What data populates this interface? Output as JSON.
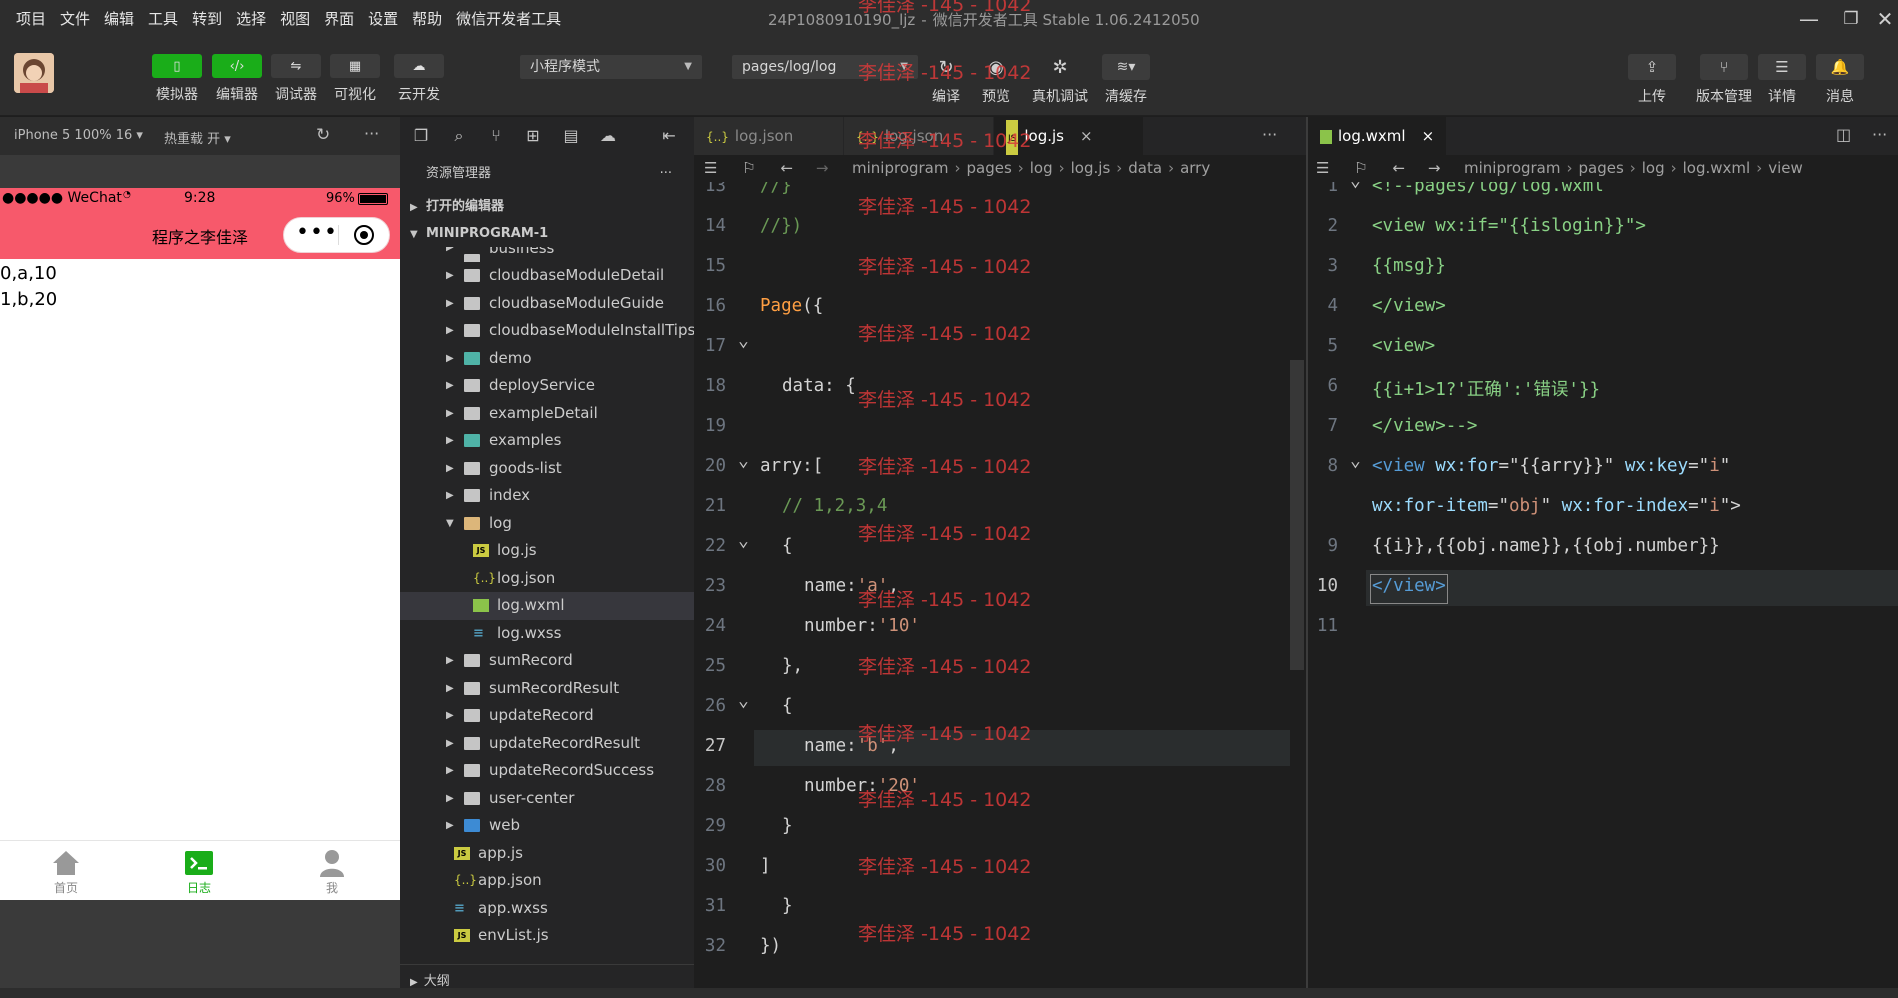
{
  "menu": [
    "项目",
    "文件",
    "编辑",
    "工具",
    "转到",
    "选择",
    "视图",
    "界面",
    "设置",
    "帮助",
    "微信开发者工具"
  ],
  "window": {
    "project": "24P1080910190_ljz",
    "sep": "-",
    "app": "微信开发者工具 Stable 1.06.2412050",
    "minimize_icon": "minimize-icon",
    "maximize_icon": "maximize-icon",
    "close_icon": "close-icon"
  },
  "toolbar": {
    "left_buttons": [
      {
        "label": "模拟器",
        "icon": "phone-icon",
        "active": true
      },
      {
        "label": "编辑器",
        "icon": "code-icon",
        "active": true
      },
      {
        "label": "调试器",
        "icon": "debug-icon",
        "active": false
      },
      {
        "label": "可视化",
        "icon": "layout-icon",
        "active": false
      },
      {
        "label": "云开发",
        "icon": "cloud-icon",
        "active": false
      }
    ],
    "mode_select": "小程序模式",
    "page_select": "pages/log/log",
    "mid_buttons": [
      {
        "label": "编译",
        "icon": "compile-icon"
      },
      {
        "label": "预览",
        "icon": "eye-icon"
      },
      {
        "label": "真机调试",
        "icon": "bug-icon"
      },
      {
        "label": "清缓存",
        "icon": "layers-icon"
      }
    ],
    "right_buttons": [
      {
        "label": "上传",
        "icon": "upload-icon"
      },
      {
        "label": "版本管理",
        "icon": "branch-icon"
      },
      {
        "label": "详情",
        "icon": "menu-icon"
      },
      {
        "label": "消息",
        "icon": "bell-icon"
      }
    ]
  },
  "simulator": {
    "device": "iPhone 5 100% 16 ▾",
    "hot_reload": "热重载 开 ▾",
    "status_left": "●●●●● WeChat",
    "status_time": "9:28",
    "status_battery": "96%",
    "nav_title": "程序之李佳泽",
    "body_lines": [
      "0,a,10",
      "1,b,20"
    ],
    "tabs": [
      {
        "label": "首页",
        "icon": "home-icon"
      },
      {
        "label": "日志",
        "icon": "terminal-icon"
      },
      {
        "label": "我",
        "icon": "user-icon"
      }
    ]
  },
  "explorer": {
    "title": "资源管理器",
    "open_editors": "打开的编辑器",
    "project": "MINIPROGRAM-1",
    "outline": "大纲",
    "items": [
      {
        "label": "business",
        "kind": "folder",
        "depth": 1,
        "open": false,
        "clipped": true
      },
      {
        "label": "cloudbaseModuleDetail",
        "kind": "folder",
        "depth": 1,
        "open": false
      },
      {
        "label": "cloudbaseModuleGuide",
        "kind": "folder",
        "depth": 1,
        "open": false
      },
      {
        "label": "cloudbaseModuleInstallTips",
        "kind": "folder",
        "depth": 1,
        "open": false
      },
      {
        "label": "demo",
        "kind": "folder-special",
        "depth": 1,
        "open": false
      },
      {
        "label": "deployService",
        "kind": "folder",
        "depth": 1,
        "open": false
      },
      {
        "label": "exampleDetail",
        "kind": "folder",
        "depth": 1,
        "open": false
      },
      {
        "label": "examples",
        "kind": "folder-special",
        "depth": 1,
        "open": false
      },
      {
        "label": "goods-list",
        "kind": "folder",
        "depth": 1,
        "open": false
      },
      {
        "label": "index",
        "kind": "folder",
        "depth": 1,
        "open": false
      },
      {
        "label": "log",
        "kind": "folder",
        "depth": 1,
        "open": true
      },
      {
        "label": "log.js",
        "kind": "js",
        "depth": 2
      },
      {
        "label": "log.json",
        "kind": "json",
        "depth": 2
      },
      {
        "label": "log.wxml",
        "kind": "wxml",
        "depth": 2,
        "selected": true
      },
      {
        "label": "log.wxss",
        "kind": "wxss",
        "depth": 2
      },
      {
        "label": "sumRecord",
        "kind": "folder",
        "depth": 1,
        "open": false
      },
      {
        "label": "sumRecordResult",
        "kind": "folder",
        "depth": 1,
        "open": false
      },
      {
        "label": "updateRecord",
        "kind": "folder",
        "depth": 1,
        "open": false
      },
      {
        "label": "updateRecordResult",
        "kind": "folder",
        "depth": 1,
        "open": false
      },
      {
        "label": "updateRecordSuccess",
        "kind": "folder",
        "depth": 1,
        "open": false
      },
      {
        "label": "user-center",
        "kind": "folder",
        "depth": 1,
        "open": false
      },
      {
        "label": "web",
        "kind": "folder-special",
        "depth": 1,
        "open": false
      },
      {
        "label": "app.js",
        "kind": "js",
        "depth": 0
      },
      {
        "label": "app.json",
        "kind": "json",
        "depth": 0
      },
      {
        "label": "app.wxss",
        "kind": "wxss",
        "depth": 0
      },
      {
        "label": "envList.js",
        "kind": "js",
        "depth": 0
      }
    ]
  },
  "left_editor": {
    "tabs": [
      {
        "label": "log.json",
        "icon": "{..}",
        "active": false
      },
      {
        "label": "log.json",
        "icon": "{..}",
        "active": false
      },
      {
        "label": "log.js",
        "icon": "JS",
        "active": true
      }
    ],
    "breadcrumb": [
      "miniprogram",
      "pages",
      "log",
      "log.js",
      "data",
      "arry"
    ],
    "current_line": 27,
    "lines": [
      {
        "n": 13,
        "parts": [
          [
            "//}",
            "comment"
          ]
        ],
        "indent": 0
      },
      {
        "n": 14,
        "parts": [
          [
            "//})",
            "comment"
          ]
        ],
        "indent": 0
      },
      {
        "n": 15,
        "parts": [],
        "indent": 0
      },
      {
        "n": 16,
        "parts": [
          [
            "Page",
            "orange"
          ],
          [
            "({",
            "plain"
          ]
        ],
        "indent": 0
      },
      {
        "n": 17,
        "parts": [],
        "indent": 0,
        "fold": true
      },
      {
        "n": 18,
        "parts": [
          [
            "data",
            "plain"
          ],
          [
            ": {",
            "plain"
          ]
        ],
        "indent": 1
      },
      {
        "n": 19,
        "parts": [],
        "indent": 0
      },
      {
        "n": 20,
        "parts": [
          [
            "arry",
            "plain"
          ],
          [
            ":[",
            "plain"
          ]
        ],
        "indent": 0,
        "fold": true
      },
      {
        "n": 21,
        "parts": [
          [
            "// 1,2,3,4",
            "comment"
          ]
        ],
        "indent": 1
      },
      {
        "n": 22,
        "parts": [
          [
            "{",
            "plain"
          ]
        ],
        "indent": 1,
        "fold": true
      },
      {
        "n": 23,
        "parts": [
          [
            "name",
            "plain"
          ],
          [
            ":",
            "plain"
          ],
          [
            "'a'",
            "str"
          ],
          [
            ",",
            "plain"
          ]
        ],
        "indent": 2
      },
      {
        "n": 24,
        "parts": [
          [
            "number",
            "plain"
          ],
          [
            ":",
            "plain"
          ],
          [
            "'10'",
            "str"
          ]
        ],
        "indent": 2
      },
      {
        "n": 25,
        "parts": [
          [
            "},",
            "plain"
          ]
        ],
        "indent": 1
      },
      {
        "n": 26,
        "parts": [
          [
            "{",
            "plain"
          ]
        ],
        "indent": 1,
        "fold": true
      },
      {
        "n": 27,
        "parts": [
          [
            "name",
            "plain"
          ],
          [
            ":",
            "plain"
          ],
          [
            "'b'",
            "str"
          ],
          [
            ",",
            "plain"
          ]
        ],
        "indent": 2
      },
      {
        "n": 28,
        "parts": [
          [
            "number",
            "plain"
          ],
          [
            ":",
            "plain"
          ],
          [
            "'20'",
            "str"
          ]
        ],
        "indent": 2
      },
      {
        "n": 29,
        "parts": [
          [
            "}",
            "plain"
          ]
        ],
        "indent": 1
      },
      {
        "n": 30,
        "parts": [
          [
            "]",
            "plain"
          ]
        ],
        "indent": 0
      },
      {
        "n": 31,
        "parts": [
          [
            "}",
            "plain"
          ]
        ],
        "indent": 1
      },
      {
        "n": 32,
        "parts": [
          [
            "})",
            "plain"
          ]
        ],
        "indent": 0
      }
    ],
    "watermark": "李佳泽 -145 - 1042"
  },
  "right_editor": {
    "tab": {
      "label": "log.wxml",
      "close": "×"
    },
    "breadcrumb": [
      "miniprogram",
      "pages",
      "log",
      "log.wxml",
      "view"
    ],
    "current_line": 10,
    "lines": [
      {
        "n": "1",
        "parts": [
          [
            "<!--pages/log/log.wxml",
            "green"
          ]
        ],
        "fold": true
      },
      {
        "n": "2",
        "parts": [
          [
            "<view wx:if=\"{{islogin}}\">",
            "green"
          ]
        ]
      },
      {
        "n": "3",
        "parts": [
          [
            "{{msg}}",
            "green"
          ]
        ]
      },
      {
        "n": "4",
        "parts": [
          [
            "</view>",
            "green"
          ]
        ]
      },
      {
        "n": "5",
        "parts": [
          [
            "<view>",
            "green"
          ]
        ]
      },
      {
        "n": "6",
        "parts": [
          [
            "{{i+1>1?'正确':'错误'}}",
            "green"
          ]
        ]
      },
      {
        "n": "7",
        "parts": [
          [
            "</view>-->",
            "green"
          ]
        ]
      },
      {
        "n": "8",
        "parts": [
          [
            "<view",
            "tag"
          ],
          [
            " wx:for",
            "attr"
          ],
          [
            "=\"{{arry}}\"",
            "plain"
          ],
          [
            " wx:key",
            "attr"
          ],
          [
            "=\"",
            "plain"
          ],
          [
            "i",
            "str"
          ],
          [
            "\"",
            "plain"
          ]
        ],
        "fold": true
      },
      {
        "n": "",
        "parts": [
          [
            "wx:for-item",
            "attr"
          ],
          [
            "=\"",
            "plain"
          ],
          [
            "obj",
            "str"
          ],
          [
            "\"",
            "plain"
          ],
          [
            " wx:for-index",
            "attr"
          ],
          [
            "=\"",
            "plain"
          ],
          [
            "i",
            "str"
          ],
          [
            "\">",
            "plain"
          ]
        ]
      },
      {
        "n": "9",
        "parts": [
          [
            "{{i}},{{obj.name}},{{obj.number}}",
            "plain"
          ]
        ]
      },
      {
        "n": "10",
        "parts": [
          [
            "</view>",
            "tag"
          ]
        ]
      },
      {
        "n": "11",
        "parts": []
      }
    ]
  }
}
